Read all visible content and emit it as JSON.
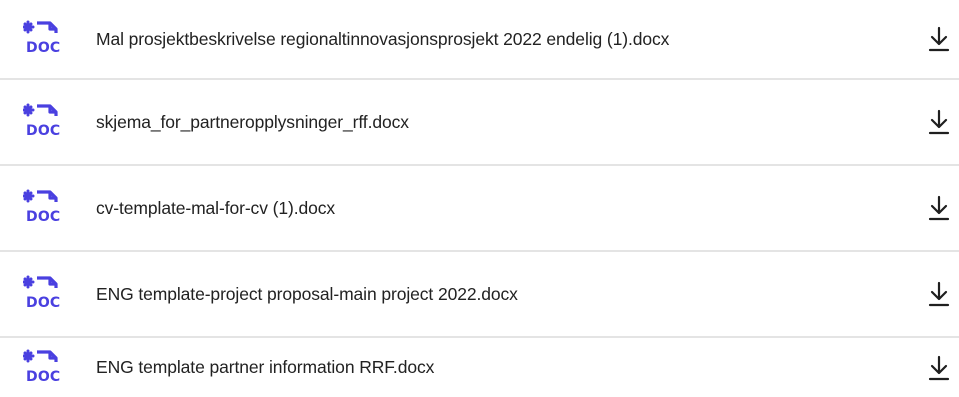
{
  "icon_color": "#4a40e0",
  "icons": {
    "file": "doc-file-icon",
    "download": "download-icon"
  },
  "files": [
    {
      "name": "Mal prosjektbeskrivelse regionaltinnovasjonsprosjekt 2022 endelig (1).docx",
      "badge": "DOC"
    },
    {
      "name": "skjema_for_partneropplysninger_rff.docx",
      "badge": "DOC"
    },
    {
      "name": "cv-template-mal-for-cv (1).docx",
      "badge": "DOC"
    },
    {
      "name": "ENG template-project proposal-main project 2022.docx",
      "badge": "DOC"
    },
    {
      "name": "ENG template partner information RRF.docx",
      "badge": "DOC"
    }
  ]
}
